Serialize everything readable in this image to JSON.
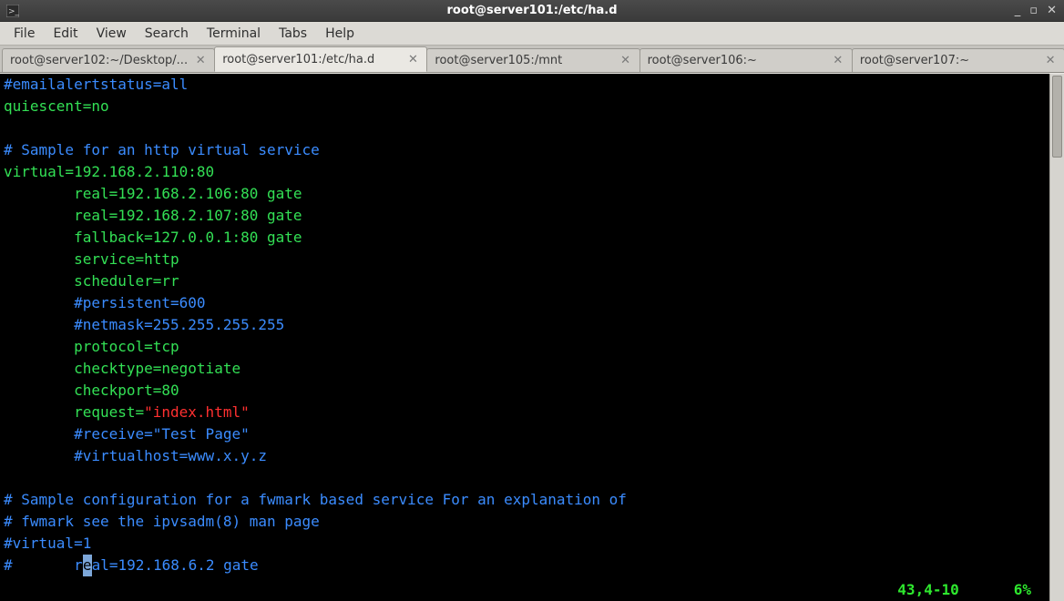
{
  "window": {
    "title": "root@server101:/etc/ha.d",
    "buttons": {
      "min": "_",
      "max": "▫",
      "close": "✕"
    }
  },
  "menu": [
    "File",
    "Edit",
    "View",
    "Search",
    "Terminal",
    "Tabs",
    "Help"
  ],
  "tabs": [
    {
      "label": "root@server102:~/Desktop/...",
      "active": false
    },
    {
      "label": "root@server101:/etc/ha.d",
      "active": true
    },
    {
      "label": "root@server105:/mnt",
      "active": false
    },
    {
      "label": "root@server106:~",
      "active": false
    },
    {
      "label": "root@server107:~",
      "active": false
    }
  ],
  "editor": {
    "lines": [
      {
        "type": "comment",
        "text": "#emailalertstatus=all"
      },
      {
        "type": "kw",
        "text": "quiescent=no"
      },
      {
        "type": "blank",
        "text": ""
      },
      {
        "type": "comment",
        "text": "# Sample for an http virtual service"
      },
      {
        "type": "kw",
        "text": "virtual=192.168.2.110:80"
      },
      {
        "type": "kw",
        "indent": 1,
        "text": "real=192.168.2.106:80 gate"
      },
      {
        "type": "kw",
        "indent": 1,
        "text": "real=192.168.2.107:80 gate"
      },
      {
        "type": "kw",
        "indent": 1,
        "text": "fallback=127.0.0.1:80 gate"
      },
      {
        "type": "kw",
        "indent": 1,
        "text": "service=http"
      },
      {
        "type": "kw",
        "indent": 1,
        "text": "scheduler=rr"
      },
      {
        "type": "comment",
        "indent": 1,
        "text": "#persistent=600"
      },
      {
        "type": "comment",
        "indent": 1,
        "text": "#netmask=255.255.255.255"
      },
      {
        "type": "kw",
        "indent": 1,
        "text": "protocol=tcp"
      },
      {
        "type": "kw",
        "indent": 1,
        "text": "checktype=negotiate"
      },
      {
        "type": "kw",
        "indent": 1,
        "text": "checkport=80"
      },
      {
        "type": "kwstr",
        "indent": 1,
        "key": "request=",
        "str": "\"index.html\""
      },
      {
        "type": "comment",
        "indent": 1,
        "text": "#receive=\"Test Page\""
      },
      {
        "type": "comment",
        "indent": 1,
        "text": "#virtualhost=www.x.y.z"
      },
      {
        "type": "blank",
        "text": ""
      },
      {
        "type": "comment",
        "text": "# Sample configuration for a fwmark based service For an explanation of"
      },
      {
        "type": "comment",
        "text": "# fwmark see the ipvsadm(8) man page"
      },
      {
        "type": "comment",
        "text": "#virtual=1"
      },
      {
        "type": "cursorline",
        "indent": 0,
        "prefix": "#       r",
        "cursor": "e",
        "suffix": "al=192.168.6.2 gate"
      }
    ],
    "status": {
      "pos": "43,4-10",
      "pct": "6%"
    }
  }
}
